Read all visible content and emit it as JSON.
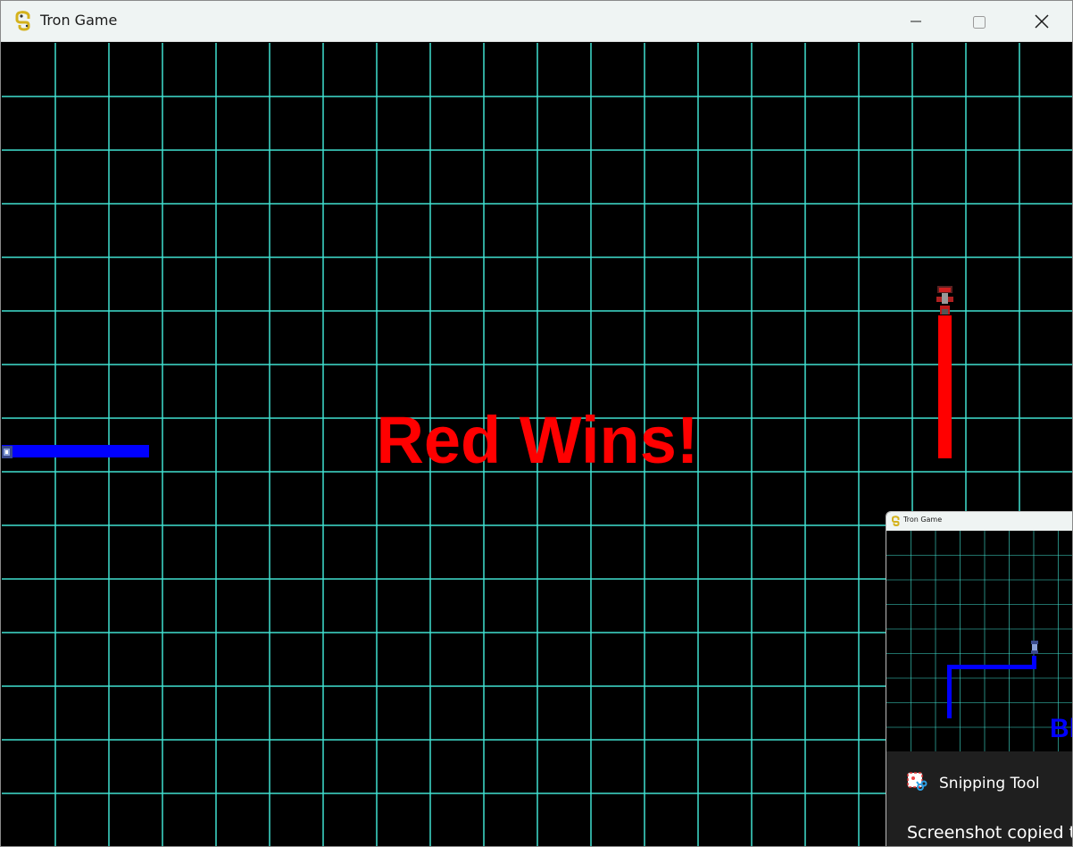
{
  "window": {
    "title": "Tron Game",
    "icon": "python-snake-icon"
  },
  "game": {
    "grid_color": "#40e0d0",
    "background": "#000000",
    "winner_text": "Red Wins!",
    "winner_color": "#ff0000",
    "red_player": {
      "color": "#ff0000",
      "trail": "vertical trail ending at top"
    },
    "blue_player": {
      "color": "#0000ff",
      "trail": "horizontal trail at left edge"
    }
  },
  "preview": {
    "title": "Tron Game",
    "winner_text_fragment": "Bl",
    "winner_color": "#0000ff"
  },
  "notification": {
    "app_name": "Snipping Tool",
    "message": "Screenshot copied to"
  }
}
